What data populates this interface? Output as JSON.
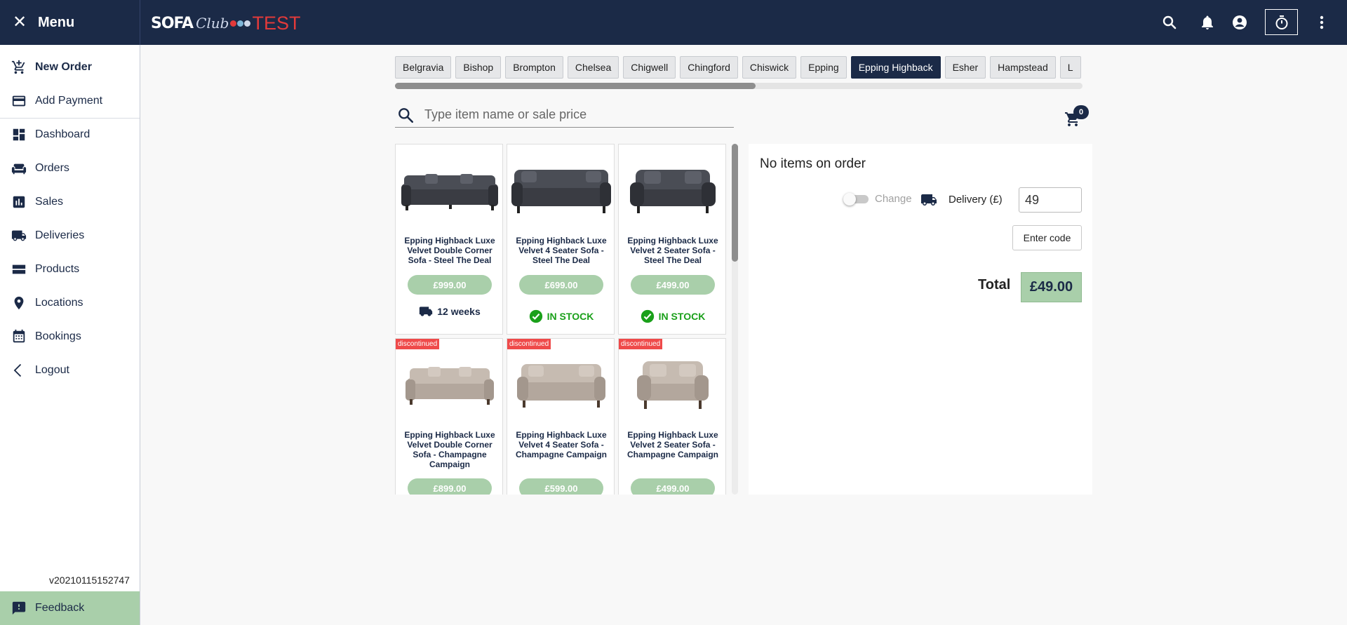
{
  "menu": {
    "title": "Menu"
  },
  "brand": {
    "word1": "SOFA",
    "word2": "Club",
    "word3": "TEST"
  },
  "sidebar": {
    "items": [
      {
        "label": "New Order"
      },
      {
        "label": "Add Payment"
      },
      {
        "label": "Dashboard"
      },
      {
        "label": "Orders"
      },
      {
        "label": "Sales"
      },
      {
        "label": "Deliveries"
      },
      {
        "label": "Products"
      },
      {
        "label": "Locations"
      },
      {
        "label": "Bookings"
      },
      {
        "label": "Logout"
      }
    ],
    "version": "v20210115152747",
    "feedback": "Feedback"
  },
  "tabs": [
    "Belgravia",
    "Bishop",
    "Brompton",
    "Chelsea",
    "Chigwell",
    "Chingford",
    "Chiswick",
    "Epping",
    "Epping Highback",
    "Esher",
    "Hampstead",
    "L"
  ],
  "active_tab": "Epping Highback",
  "search": {
    "placeholder": "Type item name or sale price",
    "value": ""
  },
  "cart": {
    "count": "0"
  },
  "products": [
    {
      "name": "Epping Highback Luxe Velvet Double Corner Sofa - Steel The Deal",
      "price": "£999.00",
      "status": "12 weeks",
      "status_type": "weeks",
      "discontinued": ""
    },
    {
      "name": "Epping Highback Luxe Velvet 4 Seater Sofa - Steel The Deal",
      "price": "£699.00",
      "status": "IN STOCK",
      "status_type": "stock",
      "discontinued": ""
    },
    {
      "name": "Epping Highback Luxe Velvet 2 Seater Sofa - Steel The Deal",
      "price": "£499.00",
      "status": "IN STOCK",
      "status_type": "stock",
      "discontinued": ""
    },
    {
      "name": "Epping Highback Luxe Velvet Double Corner Sofa - Champagne Campaign",
      "price": "£899.00",
      "status": "",
      "status_type": "",
      "discontinued": "discontinued"
    },
    {
      "name": "Epping Highback Luxe Velvet 4 Seater Sofa - Champagne Campaign",
      "price": "£599.00",
      "status": "",
      "status_type": "",
      "discontinued": "discontinued"
    },
    {
      "name": "Epping Highback Luxe Velvet 2 Seater Sofa - Champagne Campaign",
      "price": "£499.00",
      "status": "",
      "status_type": "",
      "discontinued": "discontinued"
    }
  ],
  "order": {
    "empty_text": "No items on order",
    "change_label": "Change",
    "delivery_label": "Delivery (£)",
    "delivery_value": "49",
    "enter_code": "Enter code",
    "total_label": "Total",
    "total_value": "£49.00"
  },
  "colors": {
    "navy": "#1b2a47",
    "green_price": "#a9cfaa",
    "stock_green": "#1aa01a",
    "discontinued_red": "#ef4a4a",
    "test_red": "#e23a3a"
  }
}
